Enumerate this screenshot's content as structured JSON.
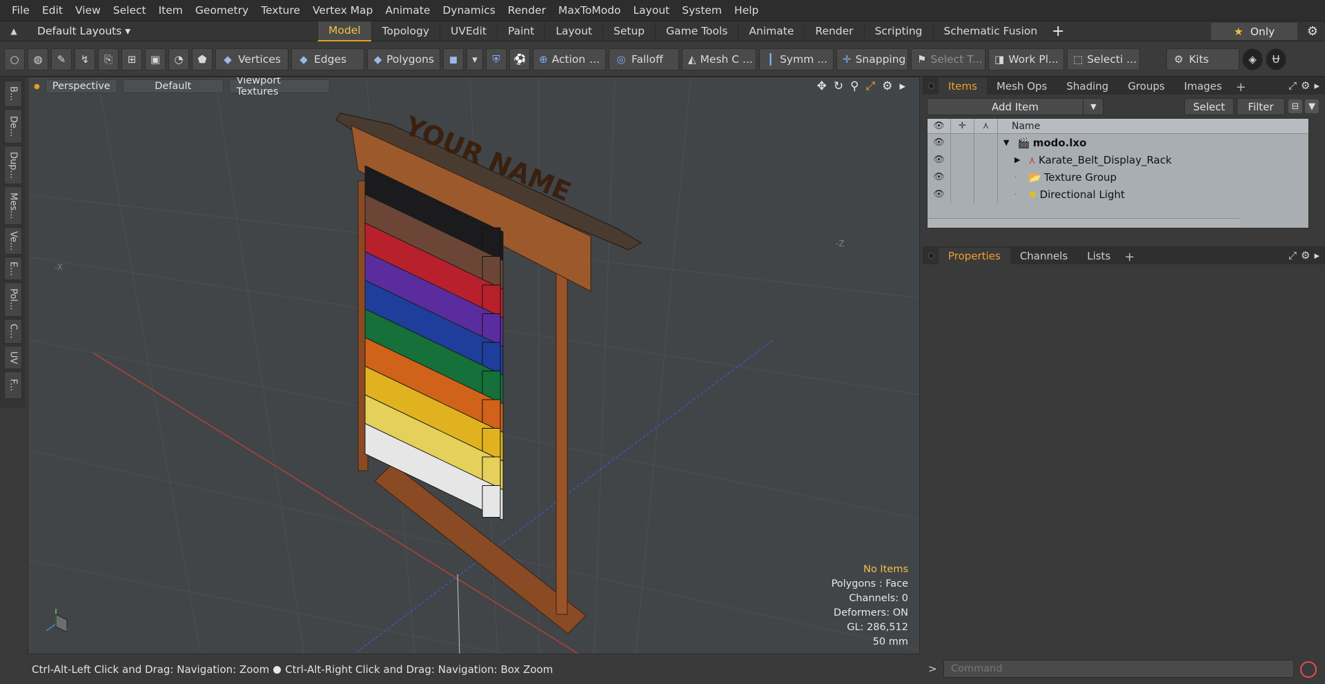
{
  "menu": [
    "File",
    "Edit",
    "View",
    "Select",
    "Item",
    "Geometry",
    "Texture",
    "Vertex Map",
    "Animate",
    "Dynamics",
    "Render",
    "MaxToModo",
    "Layout",
    "System",
    "Help"
  ],
  "layout_selector": "Default Layouts ▾",
  "layout_tabs": [
    "Model",
    "Topology",
    "UVEdit",
    "Paint",
    "Layout",
    "Setup",
    "Game Tools",
    "Animate",
    "Render",
    "Scripting",
    "Schematic Fusion"
  ],
  "active_layout_tab": "Model",
  "only_label": "Only",
  "toolbar": {
    "vertices": "Vertices",
    "edges": "Edges",
    "polygons": "Polygons",
    "action": "Action",
    "falloff": "Falloff",
    "mesh_c": "Mesh C ...",
    "symm": "Symm ...",
    "snapping": "Snapping",
    "select_t": "Select T...",
    "work_pl": "Work Pl...",
    "selecti": "Selecti ...",
    "kits": "Kits",
    "action_dots": "..."
  },
  "left_tabs": [
    "B...",
    "De...",
    "Dup...",
    "Mes...",
    "Ve...",
    "E...",
    "Pol...",
    "C...",
    "UV",
    "F..."
  ],
  "viewport": {
    "view_mode": "Perspective",
    "shading": "Default",
    "textures": "Viewport Textures",
    "model_sign_text": "YOUR NAME",
    "belt_colors": [
      "#1b1b1d",
      "#6b4637",
      "#b8212b",
      "#5b2c9e",
      "#1f3d9a",
      "#15703a",
      "#d06219",
      "#e0b21f",
      "#e4d05a",
      "#e6e6e6"
    ],
    "stats": {
      "selection": "No Items",
      "polygons": "Polygons : Face",
      "channels": "Channels: 0",
      "deformers": "Deformers: ON",
      "gl": "GL: 286,512",
      "scale": "50 mm"
    },
    "axis_labels": {
      "neg_x": "-X",
      "neg_z": "-Z"
    }
  },
  "status": {
    "hint1": "Ctrl-Alt-Left Click and Drag: Navigation: Zoom",
    "hint2": "Ctrl-Alt-Right Click and Drag: Navigation: Box Zoom"
  },
  "items_panel": {
    "tabs": [
      "Items",
      "Mesh Ops",
      "Shading",
      "Groups",
      "Images"
    ],
    "active_tab": "Items",
    "add_item": "Add Item",
    "select": "Select",
    "filter": "Filter",
    "name_header": "Name",
    "rows": [
      {
        "label": "modo.lxo",
        "bold": true
      },
      {
        "label": "Karate_Belt_Display_Rack",
        "bold": false
      },
      {
        "label": "Texture Group",
        "bold": false
      },
      {
        "label": "Directional Light",
        "bold": false
      }
    ]
  },
  "props_panel": {
    "tabs": [
      "Properties",
      "Channels",
      "Lists"
    ],
    "active_tab": "Properties"
  },
  "command": {
    "placeholder": "Command"
  },
  "colors": {
    "accent": "#f0a030",
    "active_tab_text": "#f0c040"
  }
}
